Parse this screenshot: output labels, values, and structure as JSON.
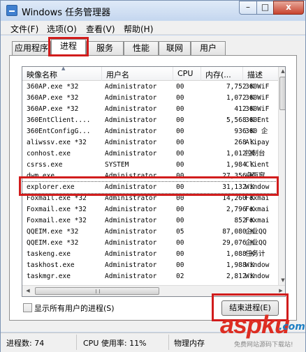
{
  "window": {
    "title": "Windows 任务管理器",
    "min_glyph": "–",
    "max_glyph": "□",
    "close_glyph": "x"
  },
  "menu": [
    "文件(F)",
    "选项(O)",
    "查看(V)",
    "帮助(H)"
  ],
  "tabs": [
    "应用程序",
    "进程",
    "服务",
    "性能",
    "联网",
    "用户"
  ],
  "active_tab": "进程",
  "columns": {
    "name": "映像名称",
    "user": "用户名",
    "cpu": "CPU",
    "memory": "内存(...",
    "desc": "描述"
  },
  "sort_glyph": "▲",
  "processes": [
    {
      "name": "360AP.exe *32",
      "user": "Administrator",
      "cpu": "00",
      "mem": "7,752 K",
      "desc": "360WiF"
    },
    {
      "name": "360AP.exe *32",
      "user": "Administrator",
      "cpu": "00",
      "mem": "1,072 K",
      "desc": "360WiF"
    },
    {
      "name": "360AP.exe *32",
      "user": "Administrator",
      "cpu": "00",
      "mem": "412 K",
      "desc": "360WiF"
    },
    {
      "name": "360EntClient....",
      "user": "Administrator",
      "cpu": "00",
      "mem": "5,568 K",
      "desc": "360Ent"
    },
    {
      "name": "360EntConfigG...",
      "user": "Administrator",
      "cpu": "00",
      "mem": "936 K",
      "desc": "360 企"
    },
    {
      "name": "aliwssv.exe *32",
      "user": "Administrator",
      "cpu": "00",
      "mem": "268 K",
      "desc": "Alipay"
    },
    {
      "name": "conhost.exe",
      "user": "Administrator",
      "cpu": "00",
      "mem": "1,012 K",
      "desc": "控制台"
    },
    {
      "name": "csrss.exe",
      "user": "SYSTEM",
      "cpu": "00",
      "mem": "1,984 K",
      "desc": "Client"
    },
    {
      "name": "dwm.exe",
      "user": "Administrator",
      "cpu": "00",
      "mem": "27,356 K",
      "desc": "桌面窗"
    },
    {
      "name": "explorer.exe",
      "user": "Administrator",
      "cpu": "00",
      "mem": "31,132 K",
      "desc": "Window"
    },
    {
      "name": "Foxmail.exe *32",
      "user": "Administrator",
      "cpu": "00",
      "mem": "14,260 K",
      "desc": "Foxmai"
    },
    {
      "name": "Foxmail.exe *32",
      "user": "Administrator",
      "cpu": "00",
      "mem": "2,796 K",
      "desc": "Foxmai"
    },
    {
      "name": "Foxmail.exe *32",
      "user": "Administrator",
      "cpu": "00",
      "mem": "852 K",
      "desc": "Foxmai"
    },
    {
      "name": "QQEIM.exe *32",
      "user": "Administrator",
      "cpu": "05",
      "mem": "87,080 K",
      "desc": "企业QQ"
    },
    {
      "name": "QQEIM.exe *32",
      "user": "Administrator",
      "cpu": "00",
      "mem": "29,076 K",
      "desc": "企业QQ"
    },
    {
      "name": "taskeng.exe",
      "user": "Administrator",
      "cpu": "00",
      "mem": "1,088 K",
      "desc": "任务计"
    },
    {
      "name": "taskhost.exe",
      "user": "Administrator",
      "cpu": "00",
      "mem": "1,988 K",
      "desc": "Window"
    },
    {
      "name": "taskmgr.exe",
      "user": "Administrator",
      "cpu": "02",
      "mem": "2,812 K",
      "desc": "Window"
    }
  ],
  "selected_process": "explorer.exe",
  "show_all_checkbox": {
    "label": "显示所有用户的进程(S)",
    "checked": false
  },
  "end_process_button": "结束进程(E)",
  "status": {
    "process_count": "进程数: 74",
    "cpu_usage": "CPU 使用率: 11%",
    "physical_memory": "物理内存"
  },
  "scroll_glyphs": {
    "up": "▲",
    "down": "▼",
    "left": "◀",
    "right": "▶"
  },
  "watermark": {
    "brand": "aspku",
    "dot": ".",
    "tld": "com",
    "tagline": "免费网站源码下载站!"
  },
  "colors": {
    "highlight": "#d11c1c",
    "selection_bg": "#ffffff"
  }
}
